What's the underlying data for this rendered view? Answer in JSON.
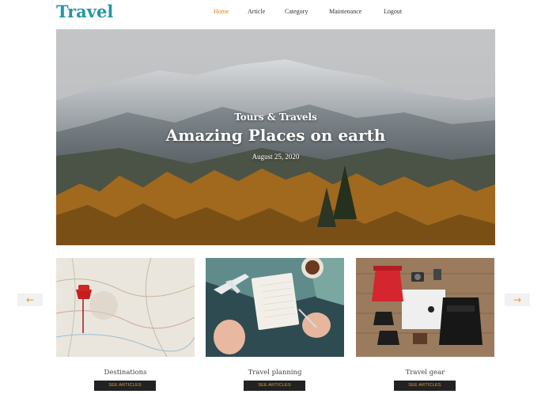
{
  "header": {
    "logo": "Travel",
    "nav": [
      {
        "label": "Home",
        "active": true
      },
      {
        "label": "Article",
        "active": false
      },
      {
        "label": "Category",
        "active": false
      },
      {
        "label": "Maintenance",
        "active": false
      },
      {
        "label": "Logout",
        "active": false
      }
    ]
  },
  "hero": {
    "subtitle": "Tours & Travels",
    "title": "Amazing Places on earth",
    "date": "August 25, 2020"
  },
  "cards": [
    {
      "title": "Destinations",
      "button": "SEE ARTICLES",
      "image": "map-with-pin"
    },
    {
      "title": "Travel planning",
      "button": "SEE ARTICLES",
      "image": "notebook-and-airplane"
    },
    {
      "title": "Travel gear",
      "button": "SEE ARTICLES",
      "image": "packed-gear-flatlay"
    }
  ],
  "carousel": {
    "prev_icon": "arrow-left-icon",
    "next_icon": "arrow-right-icon"
  },
  "colors": {
    "brand": "#2596a5",
    "accent": "#e57f21",
    "button_bg": "#222222"
  }
}
